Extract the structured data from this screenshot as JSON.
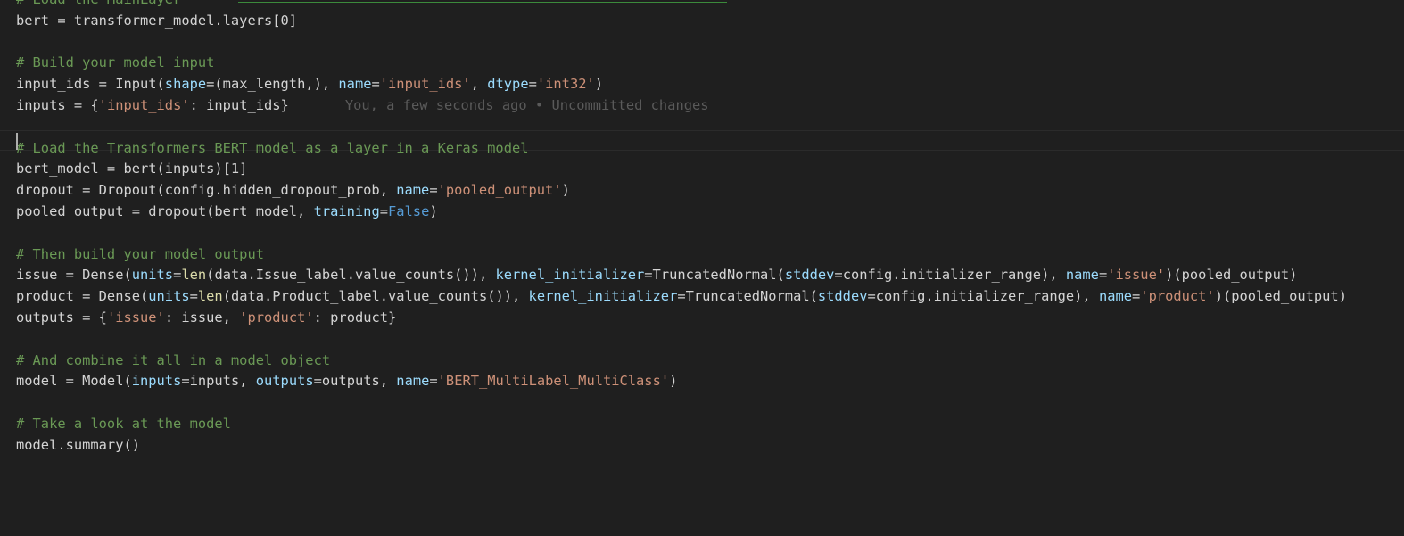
{
  "editor": {
    "blame": "You, a few seconds ago • Uncommitted changes",
    "lines": [
      {
        "name": "code-line-comment-load-mainlayer",
        "segments": [
          {
            "t": "# Load the MainLayer",
            "k": "comment"
          }
        ]
      },
      {
        "name": "code-line-bert",
        "segments": [
          {
            "t": "bert = transformer_model.layers[0]",
            "k": "plain"
          }
        ]
      },
      {
        "name": "code-line-blank",
        "segments": []
      },
      {
        "name": "code-line-comment-build-input",
        "segments": [
          {
            "t": "# Build your model input",
            "k": "comment"
          }
        ]
      },
      {
        "name": "code-line-input-ids",
        "segments": [
          {
            "t": "input_ids = Input(",
            "k": "plain"
          },
          {
            "t": "shape",
            "k": "param"
          },
          {
            "t": "=(max_length,), ",
            "k": "plain"
          },
          {
            "t": "name",
            "k": "param"
          },
          {
            "t": "=",
            "k": "plain"
          },
          {
            "t": "'input_ids'",
            "k": "string"
          },
          {
            "t": ", ",
            "k": "plain"
          },
          {
            "t": "dtype",
            "k": "param"
          },
          {
            "t": "=",
            "k": "plain"
          },
          {
            "t": "'int32'",
            "k": "string"
          },
          {
            "t": ")",
            "k": "plain"
          }
        ]
      },
      {
        "name": "code-line-inputs",
        "blame": true,
        "segments": [
          {
            "t": "inputs = {",
            "k": "plain"
          },
          {
            "t": "'input_ids'",
            "k": "string"
          },
          {
            "t": ": input_ids}",
            "k": "plain"
          }
        ]
      },
      {
        "name": "code-line-blank",
        "segments": []
      },
      {
        "name": "code-line-comment-load-transformers",
        "segments": [
          {
            "t": "# Load the Transformers BERT model as a layer in a Keras model",
            "k": "comment"
          }
        ]
      },
      {
        "name": "code-line-bert-model",
        "segments": [
          {
            "t": "bert_model = bert(inputs)[1]",
            "k": "plain"
          }
        ]
      },
      {
        "name": "code-line-dropout",
        "segments": [
          {
            "t": "dropout = Dropout(config.hidden_dropout_prob, ",
            "k": "plain"
          },
          {
            "t": "name",
            "k": "param"
          },
          {
            "t": "=",
            "k": "plain"
          },
          {
            "t": "'pooled_output'",
            "k": "string"
          },
          {
            "t": ")",
            "k": "plain"
          }
        ]
      },
      {
        "name": "code-line-pooled-output",
        "segments": [
          {
            "t": "pooled_output = dropout(bert_model, ",
            "k": "plain"
          },
          {
            "t": "training",
            "k": "param"
          },
          {
            "t": "=",
            "k": "plain"
          },
          {
            "t": "False",
            "k": "kw"
          },
          {
            "t": ")",
            "k": "plain"
          }
        ]
      },
      {
        "name": "code-line-blank",
        "segments": []
      },
      {
        "name": "code-line-comment-build-output",
        "segments": [
          {
            "t": "# Then build your model output",
            "k": "comment"
          }
        ]
      },
      {
        "name": "code-line-issue",
        "segments": [
          {
            "t": "issue = Dense(",
            "k": "plain"
          },
          {
            "t": "units",
            "k": "param"
          },
          {
            "t": "=",
            "k": "plain"
          },
          {
            "t": "len",
            "k": "fn"
          },
          {
            "t": "(data.Issue_label.value_counts()), ",
            "k": "plain"
          },
          {
            "t": "kernel_initializer",
            "k": "param"
          },
          {
            "t": "=TruncatedNormal(",
            "k": "plain"
          },
          {
            "t": "stddev",
            "k": "param"
          },
          {
            "t": "=config.initializer_range), ",
            "k": "plain"
          },
          {
            "t": "name",
            "k": "param"
          },
          {
            "t": "=",
            "k": "plain"
          },
          {
            "t": "'issue'",
            "k": "string"
          },
          {
            "t": ")(pooled_output)",
            "k": "plain"
          }
        ]
      },
      {
        "name": "code-line-product",
        "segments": [
          {
            "t": "product = Dense(",
            "k": "plain"
          },
          {
            "t": "units",
            "k": "param"
          },
          {
            "t": "=",
            "k": "plain"
          },
          {
            "t": "len",
            "k": "fn"
          },
          {
            "t": "(data.Product_label.value_counts()), ",
            "k": "plain"
          },
          {
            "t": "kernel_initializer",
            "k": "param"
          },
          {
            "t": "=TruncatedNormal(",
            "k": "plain"
          },
          {
            "t": "stddev",
            "k": "param"
          },
          {
            "t": "=config.initializer_range), ",
            "k": "plain"
          },
          {
            "t": "name",
            "k": "param"
          },
          {
            "t": "=",
            "k": "plain"
          },
          {
            "t": "'product'",
            "k": "string"
          },
          {
            "t": ")(pooled_output)",
            "k": "plain"
          }
        ]
      },
      {
        "name": "code-line-outputs",
        "segments": [
          {
            "t": "outputs = {",
            "k": "plain"
          },
          {
            "t": "'issue'",
            "k": "string"
          },
          {
            "t": ": issue, ",
            "k": "plain"
          },
          {
            "t": "'product'",
            "k": "string"
          },
          {
            "t": ": product}",
            "k": "plain"
          }
        ]
      },
      {
        "name": "code-line-blank",
        "segments": []
      },
      {
        "name": "code-line-comment-combine",
        "segments": [
          {
            "t": "# And combine it all in a model object",
            "k": "comment"
          }
        ]
      },
      {
        "name": "code-line-model",
        "segments": [
          {
            "t": "model = Model(",
            "k": "plain"
          },
          {
            "t": "inputs",
            "k": "param"
          },
          {
            "t": "=inputs, ",
            "k": "plain"
          },
          {
            "t": "outputs",
            "k": "param"
          },
          {
            "t": "=outputs, ",
            "k": "plain"
          },
          {
            "t": "name",
            "k": "param"
          },
          {
            "t": "=",
            "k": "plain"
          },
          {
            "t": "'BERT_MultiLabel_MultiClass'",
            "k": "string"
          },
          {
            "t": ")",
            "k": "plain"
          }
        ]
      },
      {
        "name": "code-line-blank",
        "segments": []
      },
      {
        "name": "code-line-comment-look",
        "segments": [
          {
            "t": "# Take a look at the model",
            "k": "comment"
          }
        ]
      },
      {
        "name": "code-line-summary",
        "segments": [
          {
            "t": "model.summary()",
            "k": "plain"
          }
        ]
      }
    ]
  },
  "colors": {
    "background": "#1f1f1f",
    "text": "#d4d4d4",
    "comment": "#6a9955",
    "parameter": "#9cdcfe",
    "string": "#ce9178",
    "keyword": "#569cd6",
    "function": "#dcdcaa",
    "blame": "#5a5a5a"
  }
}
